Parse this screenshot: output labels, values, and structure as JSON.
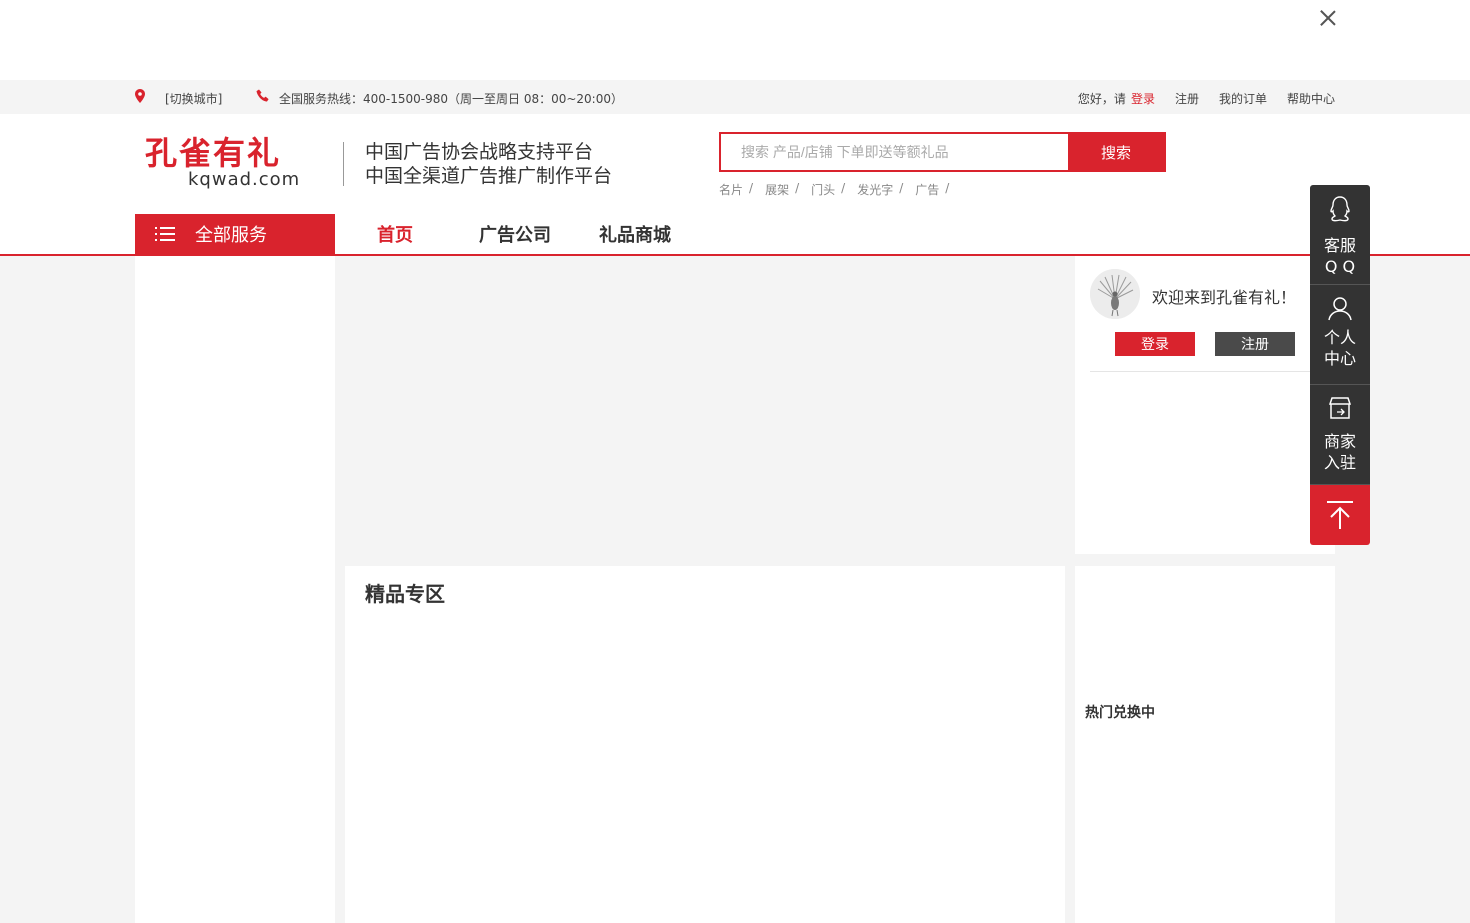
{
  "utility_bar": {
    "city_switch": "[切换城市]",
    "hotline": "全国服务热线：400-1500-980（周一至周日 08：00~20:00）",
    "greeting": "您好，请",
    "login": "登录",
    "register": "注册",
    "my_orders": "我的订单",
    "help_center": "帮助中心"
  },
  "header": {
    "logo_cn": "孔雀有礼",
    "logo_en": "kqwad.com",
    "slogan_line1": "中国广告协会战略支持平台",
    "slogan_line2": "中国全渠道广告推广制作平台",
    "search_placeholder": "搜索 产品/店铺 下单即送等额礼品",
    "search_button": "搜索",
    "hot_words": [
      "名片",
      "展架",
      "门头",
      "发光字",
      "广告"
    ],
    "hot_sep": "/"
  },
  "nav": {
    "all_services": "全部服务",
    "items": [
      "首页",
      "广告公司",
      "礼品商城"
    ]
  },
  "user_card": {
    "welcome": "欢迎来到孔雀有礼！",
    "login": "登录",
    "register": "注册"
  },
  "sections": {
    "featured_title": "精品专区",
    "hot_title": "热门兑换中"
  },
  "sidebar": {
    "qq_line1": "客服",
    "qq_line2": "Q Q",
    "personal_line1": "个人",
    "personal_line2": "中心",
    "merchant_line1": "商家",
    "merchant_line2": "入驻"
  },
  "colors": {
    "brand_red": "#d9232d",
    "dark_gray": "#333333"
  }
}
